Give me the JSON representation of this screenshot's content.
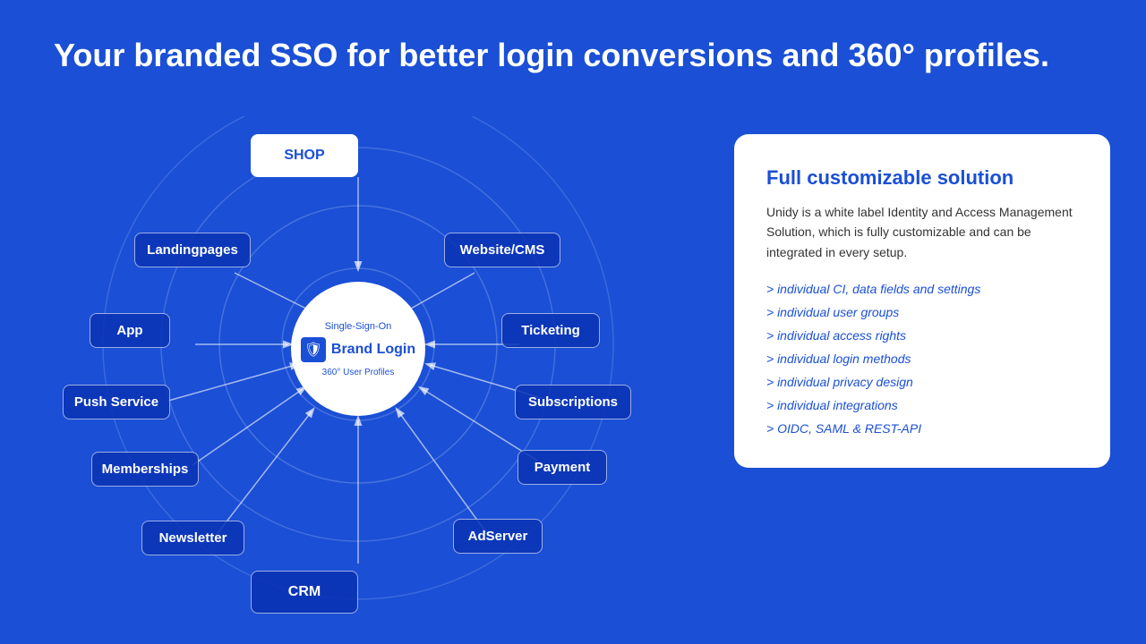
{
  "heading": "Your branded SSO for better login conversions and 360° profiles.",
  "diagram": {
    "center": {
      "label_top": "Single-Sign-On",
      "brand_text": "Brand Login",
      "label_bottom": "360° User Profiles"
    },
    "satellites": [
      {
        "id": "shop",
        "label": "SHOP",
        "pos": "top-center",
        "highlight": true
      },
      {
        "id": "landingpages",
        "label": "Landingpages",
        "pos": "top-left"
      },
      {
        "id": "website",
        "label": "Website/CMS",
        "pos": "top-right"
      },
      {
        "id": "app",
        "label": "App",
        "pos": "mid-left"
      },
      {
        "id": "ticketing",
        "label": "Ticketing",
        "pos": "mid-right"
      },
      {
        "id": "push-service",
        "label": "Push Service",
        "pos": "left"
      },
      {
        "id": "subscriptions",
        "label": "Subscriptions",
        "pos": "right-upper"
      },
      {
        "id": "memberships",
        "label": "Memberships",
        "pos": "left-lower"
      },
      {
        "id": "payment",
        "label": "Payment",
        "pos": "right-mid"
      },
      {
        "id": "newsletter",
        "label": "Newsletter",
        "pos": "bottom-left"
      },
      {
        "id": "adserver",
        "label": "AdServer",
        "pos": "bottom-right"
      },
      {
        "id": "crm",
        "label": "CRM",
        "pos": "bottom-center"
      }
    ]
  },
  "panel": {
    "title": "Full customizable solution",
    "description": "Unidy is a white label Identity and Access Management Solution, which is fully customizable and can be integrated in every setup.",
    "features": [
      "> individual CI, data fields and settings",
      "> individual user groups",
      "> individual access rights",
      "> individual login methods",
      "> individual privacy design",
      "> individual integrations",
      "> OIDC, SAML & REST-API"
    ]
  }
}
